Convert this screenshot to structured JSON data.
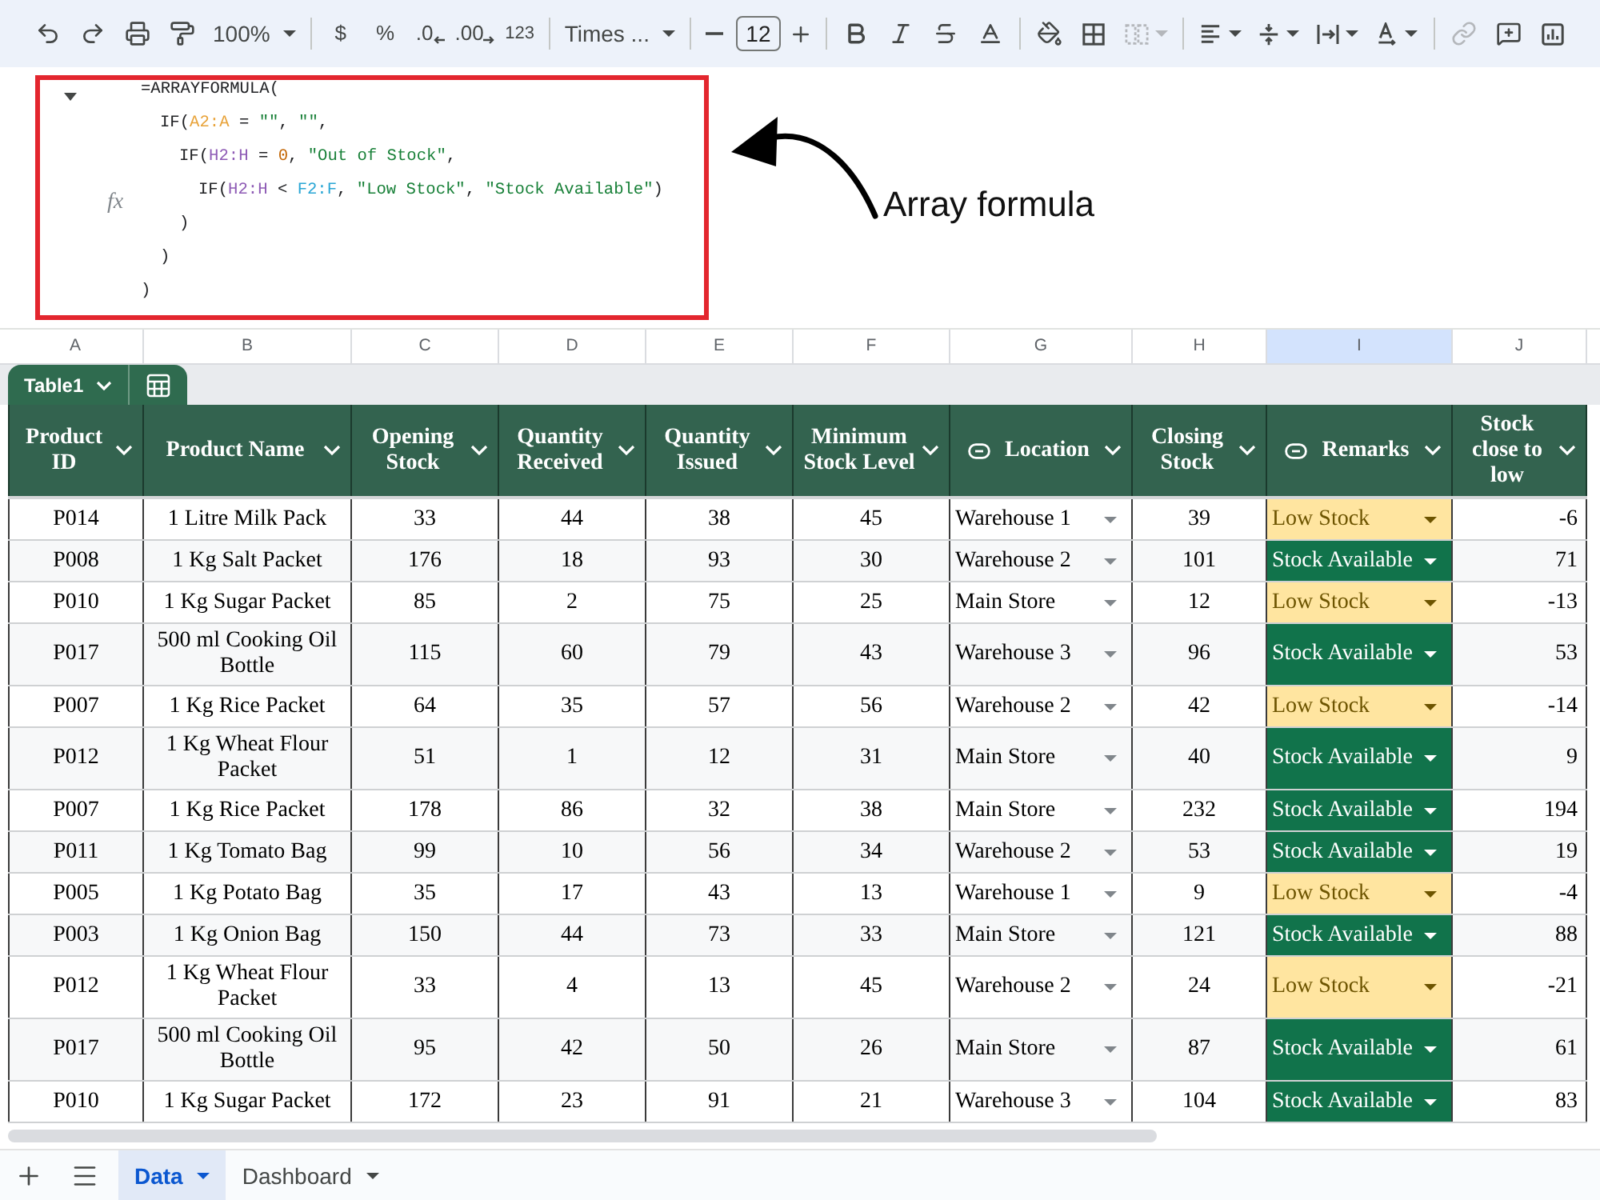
{
  "toolbar": {
    "zoom": "100%",
    "currency": "$",
    "percent": "%",
    "decrease_decimal": ".0",
    "increase_decimal": ".00",
    "number_format": "123",
    "font": "Times ...",
    "font_size": "12",
    "merge_cells": {
      "disabled": true
    },
    "insert_link": {
      "disabled": true
    }
  },
  "formula_bar": {
    "expanded": true,
    "label": "fx",
    "formula": {
      "tokens": [
        {
          "text": "=ARRAYFORMULA(",
          "color": "#202124"
        }
      ],
      "closing": ")",
      "children": [
        {
          "tokens": [
            {
              "text": "IF(",
              "color": "#202124"
            },
            {
              "text": "A2:A",
              "color": "#e8a33a"
            },
            {
              "text": " = ",
              "color": "#202124"
            },
            {
              "text": "\"\"",
              "color": "#188038"
            },
            {
              "text": ", ",
              "color": "#202124"
            },
            {
              "text": "\"\"",
              "color": "#188038"
            },
            {
              "text": ",",
              "color": "#202124"
            }
          ],
          "closing": ")",
          "children": [
            {
              "tokens": [
                {
                  "text": "IF(",
                  "color": "#202124"
                },
                {
                  "text": "H2:H",
                  "color": "#8e5bb5"
                },
                {
                  "text": " = ",
                  "color": "#202124"
                },
                {
                  "text": "0",
                  "color": "#c26401"
                },
                {
                  "text": ", ",
                  "color": "#202124"
                },
                {
                  "text": "\"Out of Stock\"",
                  "color": "#188038"
                },
                {
                  "text": ",",
                  "color": "#202124"
                }
              ],
              "closing": ")",
              "children": [
                {
                  "tokens": [
                    {
                      "text": "IF(",
                      "color": "#202124"
                    },
                    {
                      "text": "H2:H",
                      "color": "#8e5bb5"
                    },
                    {
                      "text": " < ",
                      "color": "#202124"
                    },
                    {
                      "text": "F2:F",
                      "color": "#2aa6d5"
                    },
                    {
                      "text": ", ",
                      "color": "#202124"
                    },
                    {
                      "text": "\"Low Stock\"",
                      "color": "#188038"
                    },
                    {
                      "text": ", ",
                      "color": "#202124"
                    },
                    {
                      "text": "\"Stock Available\"",
                      "color": "#188038"
                    },
                    {
                      "text": ")",
                      "color": "#202124"
                    }
                  ]
                }
              ]
            }
          ]
        }
      ]
    }
  },
  "annotation": "Array formula",
  "column_letters": [
    {
      "letter": "A",
      "selected": false
    },
    {
      "letter": "B",
      "selected": false
    },
    {
      "letter": "C",
      "selected": false
    },
    {
      "letter": "D",
      "selected": false
    },
    {
      "letter": "E",
      "selected": false
    },
    {
      "letter": "F",
      "selected": false
    },
    {
      "letter": "G",
      "selected": false
    },
    {
      "letter": "H",
      "selected": false
    },
    {
      "letter": "I",
      "selected": true
    },
    {
      "letter": "J",
      "selected": false
    }
  ],
  "table": {
    "name": "Table1",
    "columns": [
      {
        "label": "Product ID",
        "kind": "plain"
      },
      {
        "label": "Product Name",
        "kind": "plain"
      },
      {
        "label": "Opening Stock",
        "kind": "plain"
      },
      {
        "label": "Quantity Received",
        "kind": "plain"
      },
      {
        "label": "Quantity Issued",
        "kind": "plain"
      },
      {
        "label": "Minimum Stock Level",
        "kind": "plain"
      },
      {
        "label": "Location",
        "kind": "dropdown"
      },
      {
        "label": "Closing Stock",
        "kind": "plain"
      },
      {
        "label": "Remarks",
        "kind": "chip"
      },
      {
        "label": "Stock close to low",
        "kind": "formula"
      }
    ],
    "rows": [
      {
        "cells": [
          "P014",
          "1 Litre Milk Pack",
          "33",
          "44",
          "38",
          "45",
          "Warehouse 1",
          "39",
          {
            "text": "Low Stock",
            "color": "#ffe5a0"
          },
          "-6"
        ]
      },
      {
        "cells": [
          "P008",
          "1 Kg Salt Packet",
          "176",
          "18",
          "93",
          "30",
          "Warehouse 2",
          "101",
          {
            "text": "Stock Available",
            "color": "#11734b"
          },
          "71"
        ]
      },
      {
        "cells": [
          "P010",
          "1 Kg Sugar Packet",
          "85",
          "2",
          "75",
          "25",
          "Main Store",
          "12",
          {
            "text": "Low Stock",
            "color": "#ffe5a0"
          },
          "-13"
        ]
      },
      {
        "cells": [
          "P017",
          "500 ml Cooking Oil Bottle",
          "115",
          "60",
          "79",
          "43",
          "Warehouse 3",
          "96",
          {
            "text": "Stock Available",
            "color": "#11734b"
          },
          "53"
        ]
      },
      {
        "cells": [
          "P007",
          "1 Kg Rice Packet",
          "64",
          "35",
          "57",
          "56",
          "Warehouse 2",
          "42",
          {
            "text": "Low Stock",
            "color": "#ffe5a0"
          },
          "-14"
        ]
      },
      {
        "cells": [
          "P012",
          "1 Kg Wheat Flour Packet",
          "51",
          "1",
          "12",
          "31",
          "Main Store",
          "40",
          {
            "text": "Stock Available",
            "color": "#11734b"
          },
          "9"
        ]
      },
      {
        "cells": [
          "P007",
          "1 Kg Rice Packet",
          "178",
          "86",
          "32",
          "38",
          "Main Store",
          "232",
          {
            "text": "Stock Available",
            "color": "#11734b"
          },
          "194"
        ]
      },
      {
        "cells": [
          "P011",
          "1 Kg Tomato Bag",
          "99",
          "10",
          "56",
          "34",
          "Warehouse 2",
          "53",
          {
            "text": "Stock Available",
            "color": "#11734b"
          },
          "19"
        ]
      },
      {
        "cells": [
          "P005",
          "1 Kg Potato Bag",
          "35",
          "17",
          "43",
          "13",
          "Warehouse 1",
          "9",
          {
            "text": "Low Stock",
            "color": "#ffe5a0"
          },
          "-4"
        ]
      },
      {
        "cells": [
          "P003",
          "1 Kg Onion Bag",
          "150",
          "44",
          "73",
          "33",
          "Main Store",
          "121",
          {
            "text": "Stock Available",
            "color": "#11734b"
          },
          "88"
        ]
      },
      {
        "cells": [
          "P012",
          "1 Kg Wheat Flour Packet",
          "33",
          "4",
          "13",
          "45",
          "Warehouse 2",
          "24",
          {
            "text": "Low Stock",
            "color": "#ffe5a0"
          },
          "-21"
        ]
      },
      {
        "cells": [
          "P017",
          "500 ml Cooking Oil Bottle",
          "95",
          "42",
          "50",
          "26",
          "Main Store",
          "87",
          {
            "text": "Stock Available",
            "color": "#11734b"
          },
          "61"
        ]
      },
      {
        "cells": [
          "P010",
          "1 Kg Sugar Packet",
          "172",
          "23",
          "91",
          "21",
          "Warehouse 3",
          "104",
          {
            "text": "Stock Available",
            "color": "#11734b"
          },
          "83"
        ]
      }
    ]
  },
  "sheets": [
    {
      "label": "Data",
      "selected": true
    },
    {
      "label": "Dashboard",
      "selected": false
    }
  ]
}
